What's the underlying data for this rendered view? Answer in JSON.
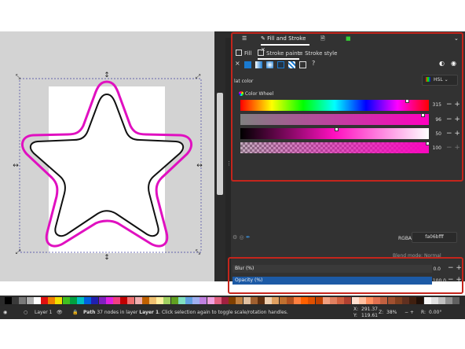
{
  "dialog": {
    "tab_title": "Fill and Stroke",
    "tab_close": "×",
    "subtabs": {
      "fill": "Fill",
      "stroke_paint": "Stroke paint",
      "stroke_style": "Stroke style"
    },
    "unset_label": "?",
    "section_title": "lat color",
    "mode_select": "HSL",
    "wheel_label": "Color Wheel",
    "channels": [
      {
        "value": "315"
      },
      {
        "value": "96"
      },
      {
        "value": "50"
      },
      {
        "value": "100"
      }
    ],
    "rgba_label": "RGBA:",
    "rgba_value": "fa06bfff",
    "blend_partial": "Blend mode: Normal",
    "blur_label": "Blur (%)",
    "blur_value": "0.0",
    "opacity_label": "Opacity (%)",
    "opacity_value": "100.0"
  },
  "statusbar": {
    "layer_label": "Layer 1",
    "message_bold": "Path",
    "message": "37 nodes in layer",
    "message_layer": "Layer 1",
    "message_rest": ". Click selection again to toggle scale/rotation handles.",
    "x_label": "X:",
    "x_value": "291.37",
    "y_label": "Y:",
    "y_value": "119.61",
    "zoom_label": "Z:",
    "zoom_value": "38%",
    "rot_label": "R:",
    "rot_value": "0.00°"
  },
  "colors": {
    "accent_red": "#c4251c",
    "stroke_magenta": "#e010c0",
    "opacity_fill": "#1c5aa6"
  },
  "palette": [
    "#000000",
    "#3a3a3a",
    "#7a7a7a",
    "#b0b0b0",
    "#ffffff",
    "#e01010",
    "#f08000",
    "#f0e000",
    "#40c020",
    "#00a040",
    "#00c0c0",
    "#0060e0",
    "#2020b0",
    "#8020c0",
    "#e020e0",
    "#f04080",
    "#c00000",
    "#f07070",
    "#f0b0b0",
    "#c06000",
    "#f0c070",
    "#fff0a0",
    "#a0d060",
    "#60a020",
    "#80e0c0",
    "#60a0e0",
    "#a0b0f0",
    "#c080e0",
    "#f0a0e0",
    "#e06080",
    "#a02040",
    "#804000",
    "#c08040",
    "#e0c0a0",
    "#a06030",
    "#603010",
    "#f0d0b0",
    "#e0a060",
    "#c07030",
    "#b05020",
    "#ff8040",
    "#ff6000",
    "#e05000",
    "#c04000",
    "#f0a080",
    "#e08060",
    "#d06040",
    "#b04030",
    "#ffe0d0",
    "#ffc0a0",
    "#ff9060",
    "#e07050",
    "#c06040",
    "#a05030",
    "#804020",
    "#603020",
    "#402010",
    "#201008",
    "#f8f8f8",
    "#e0e0e0",
    "#c0c0c0",
    "#909090",
    "#606060"
  ]
}
